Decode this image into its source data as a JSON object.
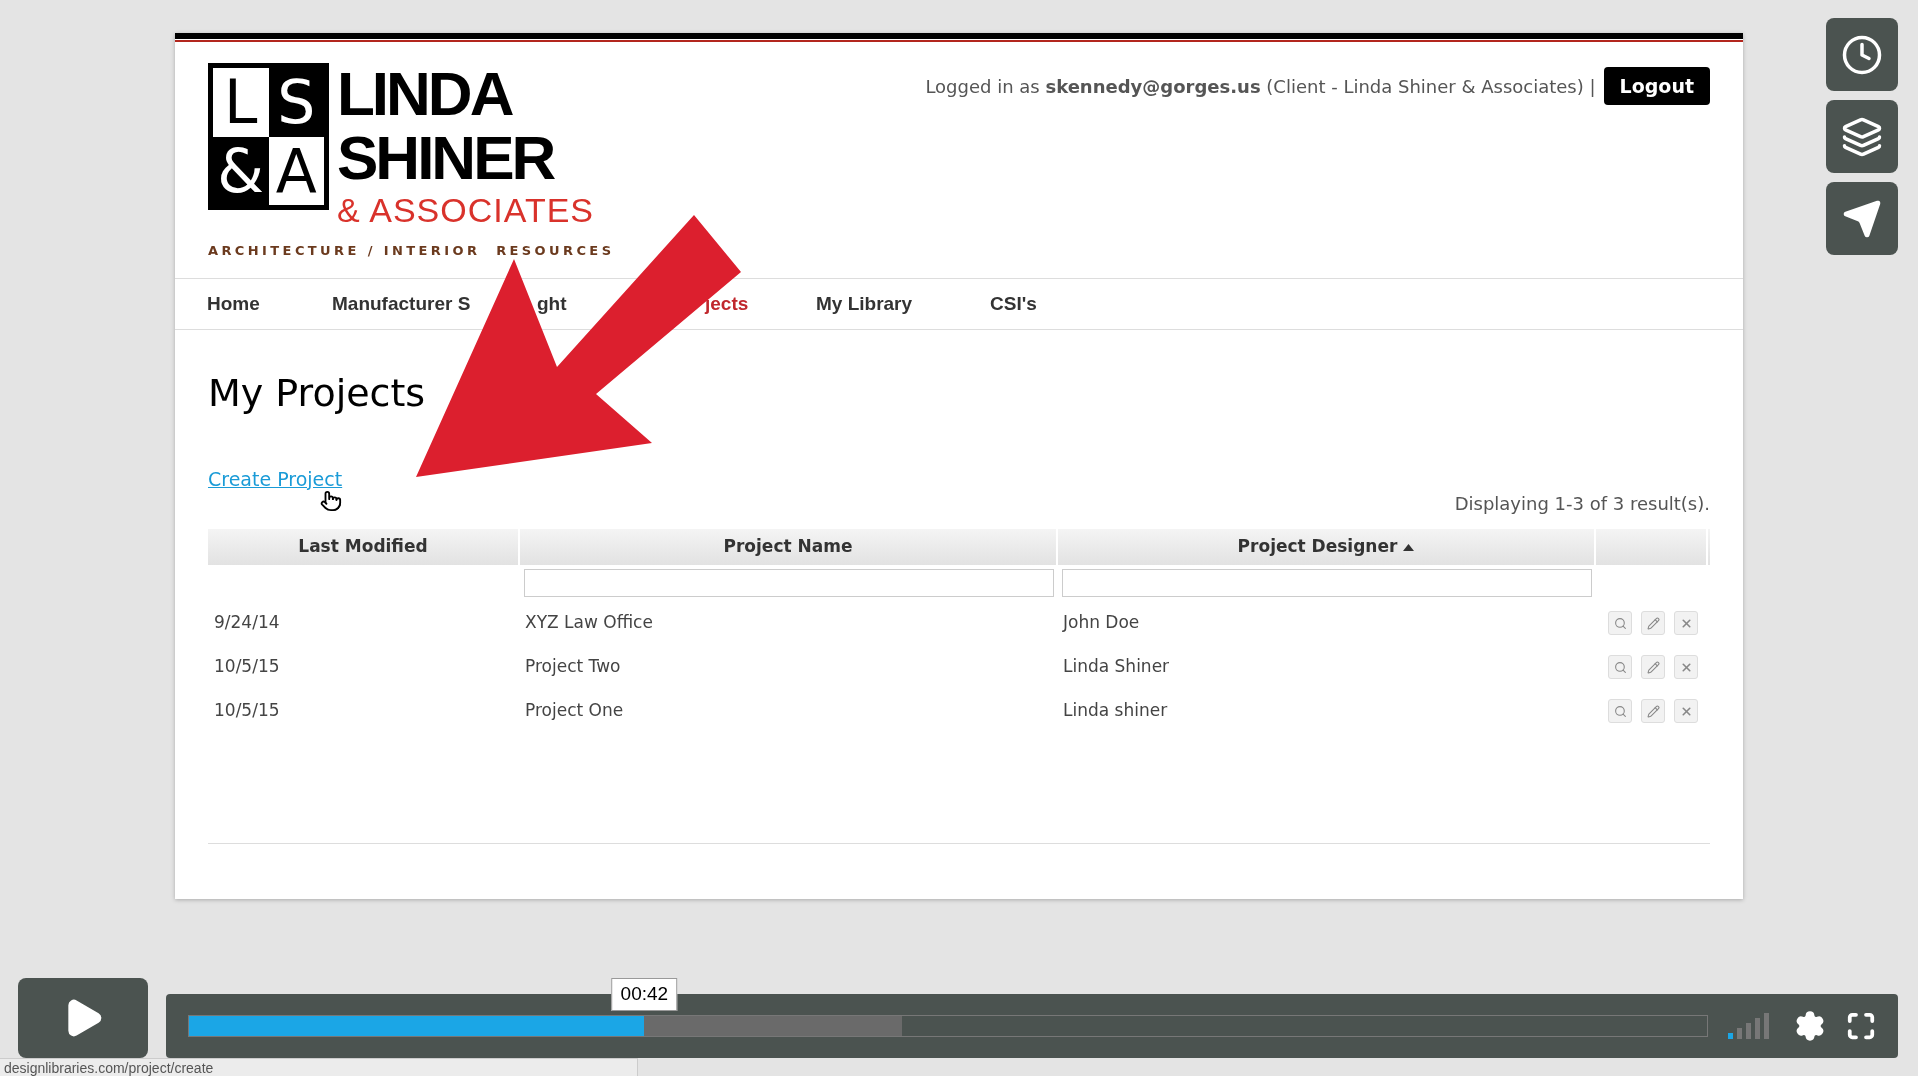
{
  "logo": {
    "letters": [
      "L",
      "S",
      "&",
      "A"
    ],
    "lines": [
      "LINDA",
      "SHINER",
      "& ASSOCIATES"
    ],
    "tagline": "ARCHITECTURE / INTERIOR  RESOURCES"
  },
  "header": {
    "login_text": "Logged in as **skennedy@gorges.us** (Client - Linda Shiner & Associates) |",
    "logout": "Logout"
  },
  "nav": [
    {
      "label": "Home",
      "selected": false
    },
    {
      "label": "Manufacturer S",
      "selected": false
    },
    {
      "label": "ght",
      "selected": false
    },
    {
      "label": "jects",
      "selected": true
    },
    {
      "label": "My Library",
      "selected": false
    },
    {
      "label": "CSI's",
      "selected": false
    }
  ],
  "page": {
    "title": "My Projects",
    "create_link": "Create Project",
    "summary": "Displaying 1-3 of 3 result(s)."
  },
  "table": {
    "columns": [
      {
        "label": "Last Modified"
      },
      {
        "label": "Project Name",
        "filter": true
      },
      {
        "label": "Project Designer",
        "sorted": true,
        "filter": true
      },
      {}
    ],
    "rows": [
      {
        "modified": "9/24/14",
        "name": "XYZ Law Office",
        "designer": "John Doe"
      },
      {
        "modified": "10/5/15",
        "name": "Project Two",
        "designer": "Linda Shiner"
      },
      {
        "modified": "10/5/15",
        "name": "Project One",
        "designer": "Linda shiner"
      }
    ]
  },
  "player": {
    "time": "00:42",
    "played": {
      "level": 0.3
    },
    "buffered": {
      "level": 0.47
    },
    "status_url": "designlibraries.com/project/create"
  }
}
